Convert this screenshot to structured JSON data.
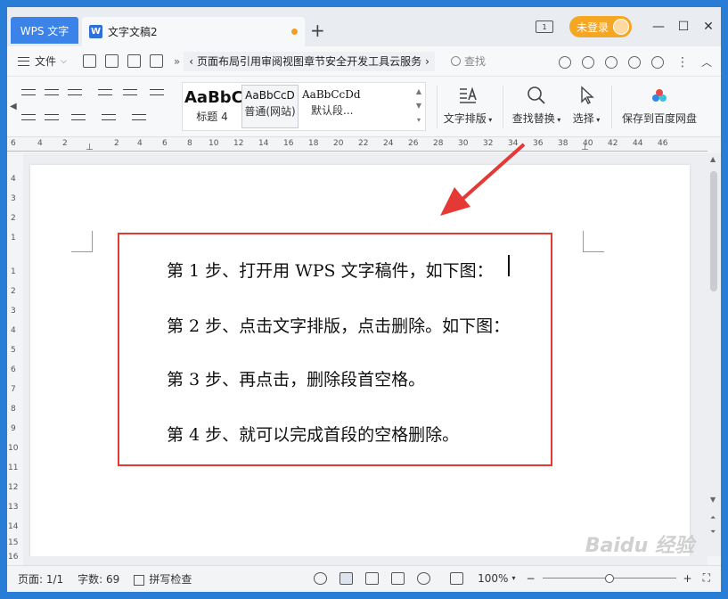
{
  "titlebar": {
    "app_tab": "WPS 文字",
    "doc_tab": "文字文稿2",
    "doc_icon_letter": "W",
    "new_tab": "+",
    "layout_icon_text": "1",
    "login_label": "未登录",
    "win_min": "—",
    "win_max": "☐",
    "win_close": "✕"
  },
  "menubar": {
    "file_label": "文件",
    "more": "»",
    "prev": "‹",
    "next": "›",
    "tabs": [
      "页面布局",
      "引用",
      "审阅",
      "视图",
      "章节",
      "安全",
      "开发工具",
      "云服务"
    ],
    "search_label": "查找"
  },
  "ribbon": {
    "styles": [
      {
        "preview": "AaBbC",
        "name": "标题 4"
      },
      {
        "preview": "AaBbCcD",
        "name": "普通(网站)"
      },
      {
        "preview": "AaBbCcDd",
        "name": "默认段..."
      }
    ],
    "text_layout": "文字排版",
    "find_replace": "查找替换",
    "select": "选择",
    "save_baidu": "保存到百度网盘"
  },
  "ruler": {
    "h_labels": [
      "6",
      "4",
      "2",
      "2",
      "4",
      "6",
      "8",
      "10",
      "12",
      "14",
      "16",
      "18",
      "20",
      "22",
      "24",
      "26",
      "28",
      "30",
      "32",
      "34",
      "36",
      "38",
      "40",
      "42",
      "44",
      "46"
    ],
    "v_labels": [
      "4",
      "3",
      "2",
      "1",
      "1",
      "2",
      "3",
      "4",
      "5",
      "6",
      "7",
      "8",
      "9",
      "10",
      "11",
      "12",
      "13",
      "14",
      "15",
      "16"
    ]
  },
  "document": {
    "lines": [
      "第 1 步、打开用 WPS 文字稿件，如下图：",
      "第 2 步、点击文字排版，点击删除。如下图：",
      "第 3 步、再点击，删除段首空格。",
      "第 4 步、就可以完成首段的空格删除。"
    ]
  },
  "status": {
    "page": "页面: 1/1",
    "words": "字数: 69",
    "spellcheck": "拼写检查",
    "zoom": "100%",
    "zoom_minus": "−",
    "zoom_plus": "+",
    "zoom_level": 0.5
  },
  "colors": {
    "accent": "#3b83e8",
    "login": "#f5a623",
    "highlight_box": "#e53935",
    "arrow": "#e53935"
  },
  "watermark": "Baidu 经验"
}
